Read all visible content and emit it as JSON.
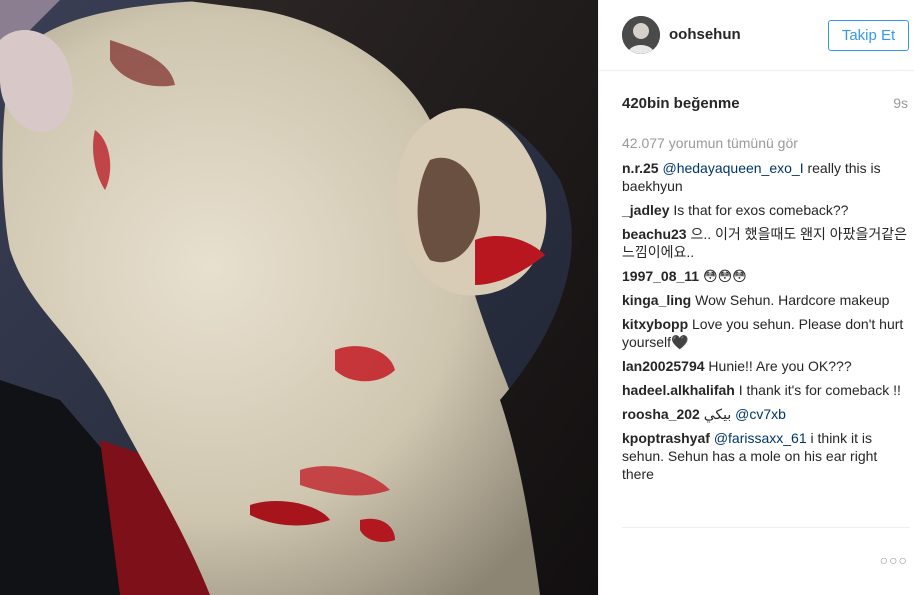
{
  "post": {
    "username": "oohsehun",
    "follow_label": "Takip Et",
    "likes": "420bin beğenme",
    "time": "9s",
    "view_all_comments": "42.077 yorumun tümünü gör",
    "more_icon": "ellipsis-icon",
    "comments": [
      {
        "user": "n.r.25",
        "text": "@hedayaqueen_exo_I really this is baekhyun"
      },
      {
        "user": "_jadley",
        "text": "Is that for exos comeback??"
      },
      {
        "user": "beachu23",
        "text": "으.. 이거 했을때도 왠지 아팠을거같은 느낌이에요.."
      },
      {
        "user": "1997_08_11",
        "text": "😳😳😳"
      },
      {
        "user": "kinga_ling",
        "text": "Wow Sehun. Hardcore makeup"
      },
      {
        "user": "kitxybopp",
        "text": "Love you sehun. Please don't hurt yourself🖤"
      },
      {
        "user": "lan20025794",
        "text": "Hunie!! Are you OK???"
      },
      {
        "user": "hadeel.alkhalifah",
        "text": "I thank it's for comeback !!"
      },
      {
        "user": "roosha_202",
        "text": "بيكي @cv7xb"
      },
      {
        "user": "kpoptrashyaf",
        "text": "@farissaxx_61 i think it is sehun. Sehun has a mole on his ear right there"
      }
    ]
  },
  "colors": {
    "accent": "#3897f0",
    "mention": "#003569",
    "muted": "#999999"
  }
}
